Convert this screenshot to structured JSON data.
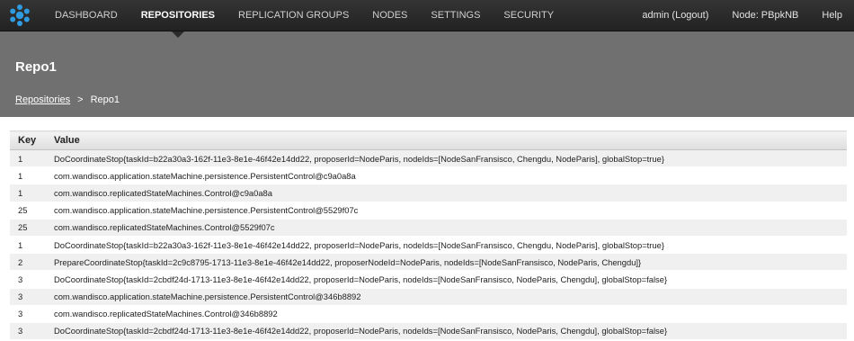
{
  "nav": {
    "items": [
      {
        "label": "DASHBOARD"
      },
      {
        "label": "REPOSITORIES"
      },
      {
        "label": "REPLICATION GROUPS"
      },
      {
        "label": "NODES"
      },
      {
        "label": "SETTINGS"
      },
      {
        "label": "SECURITY"
      }
    ],
    "active": "REPOSITORIES",
    "user": "admin (Logout)",
    "node": "Node: PBpkNB",
    "help": "Help"
  },
  "header": {
    "title": "Repo1",
    "breadcrumb": {
      "link": "Repositories",
      "separator": ">",
      "current": "Repo1"
    }
  },
  "table": {
    "columns": [
      "Key",
      "Value"
    ],
    "rows": [
      {
        "key": "1",
        "value": "DoCoordinateStop{taskId=b22a30a3-162f-11e3-8e1e-46f42e14dd22, proposerId=NodeParis, nodeIds=[NodeSanFransisco, Chengdu, NodeParis], globalStop=true}"
      },
      {
        "key": "1",
        "value": "com.wandisco.application.stateMachine.persistence.PersistentControl@c9a0a8a"
      },
      {
        "key": "1",
        "value": "com.wandisco.replicatedStateMachines.Control@c9a0a8a"
      },
      {
        "key": "25",
        "value": "com.wandisco.application.stateMachine.persistence.PersistentControl@5529f07c"
      },
      {
        "key": "25",
        "value": "com.wandisco.replicatedStateMachines.Control@5529f07c"
      },
      {
        "key": "1",
        "value": "DoCoordinateStop{taskId=b22a30a3-162f-11e3-8e1e-46f42e14dd22, proposerId=NodeParis, nodeIds=[NodeSanFransisco, Chengdu, NodeParis], globalStop=true}"
      },
      {
        "key": "2",
        "value": "PrepareCoordinateStop{taskId=2c9c8795-1713-11e3-8e1e-46f42e14dd22, proposerNodeId=NodeParis, nodeIds=[NodeSanFransisco, NodeParis, Chengdu]}"
      },
      {
        "key": "3",
        "value": "DoCoordinateStop{taskId=2cbdf24d-1713-11e3-8e1e-46f42e14dd22, proposerId=NodeParis, nodeIds=[NodeSanFransisco, NodeParis, Chengdu], globalStop=false}"
      },
      {
        "key": "3",
        "value": "com.wandisco.application.stateMachine.persistence.PersistentControl@346b8892"
      },
      {
        "key": "3",
        "value": "com.wandisco.replicatedStateMachines.Control@346b8892"
      },
      {
        "key": "3",
        "value": "DoCoordinateStop{taskId=2cbdf24d-1713-11e3-8e1e-46f42e14dd22, proposerId=NodeParis, nodeIds=[NodeSanFransisco, NodeParis, Chengdu], globalStop=false}"
      }
    ]
  },
  "colors": {
    "topbar": "#2a2a2a",
    "header": "#707070",
    "logo": "#2f9be0",
    "row_stripe": "#f0f0f0"
  },
  "icons": {
    "logo": "wandisco-logo-icon"
  }
}
